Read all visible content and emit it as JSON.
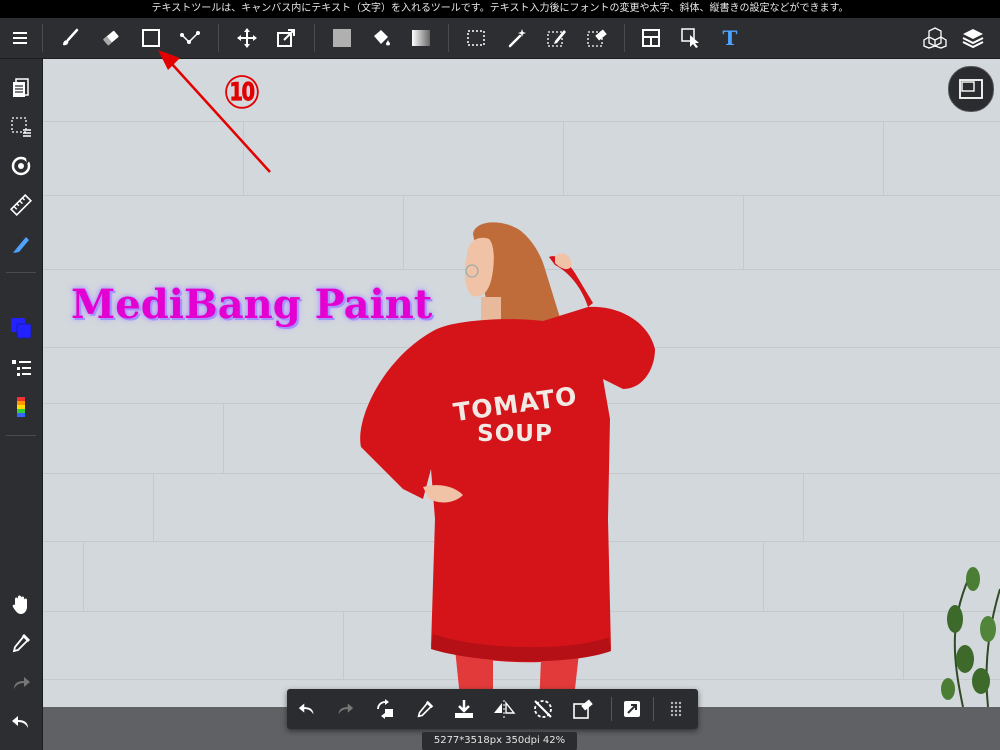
{
  "status_bar": {
    "hint": "テキストツールは、キャンバス内にテキスト（文字）を入れるツールです。テキスト入力後にフォントの変更や太字、斜体、縦書きの設定などができます。"
  },
  "toolbar": {
    "items": [
      {
        "icon": "menu-icon"
      },
      {
        "icon": "brush-icon"
      },
      {
        "icon": "eraser-icon"
      },
      {
        "icon": "rectangle-shape-icon"
      },
      {
        "icon": "curve-line-icon"
      },
      {
        "icon": "move-icon"
      },
      {
        "icon": "transform-icon"
      },
      {
        "icon": "fill-color-icon"
      },
      {
        "icon": "bucket-icon"
      },
      {
        "icon": "gradient-icon"
      },
      {
        "icon": "select-icon"
      },
      {
        "icon": "magic-wand-icon"
      },
      {
        "icon": "select-pen-icon"
      },
      {
        "icon": "select-eraser-icon"
      },
      {
        "icon": "divide-icon"
      },
      {
        "icon": "operation-icon"
      },
      {
        "icon": "text-tool-icon",
        "label": "T",
        "color": "#4ea3ff"
      },
      {
        "icon": "material-icon"
      },
      {
        "icon": "layers-icon"
      }
    ]
  },
  "sidebar": {
    "items": [
      {
        "icon": "page-icon"
      },
      {
        "icon": "selection-list-icon"
      },
      {
        "icon": "rotate-icon"
      },
      {
        "icon": "ruler-icon"
      },
      {
        "icon": "pen-tool-icon",
        "color": "#4ea3ff"
      },
      {
        "icon": "color-icon",
        "color": "#2222ff"
      },
      {
        "icon": "layer-list-icon"
      },
      {
        "icon": "palette-icon"
      },
      {
        "icon": "hand-icon"
      },
      {
        "icon": "eyedropper-icon"
      },
      {
        "icon": "redo-icon"
      },
      {
        "icon": "undo-icon"
      }
    ]
  },
  "canvas": {
    "overlay_text": "MediBang Paint",
    "sweatshirt_text": {
      "line1": "TOMATO",
      "line2": "SOUP"
    },
    "shirt_color": "#d5141a",
    "wall_color": "#d3d8dd",
    "text_color": "#e400d0"
  },
  "annotation": {
    "number": "⑩",
    "color": "#e30000"
  },
  "bottom_bar": {
    "items": [
      {
        "icon": "undo-icon"
      },
      {
        "icon": "redo-icon"
      },
      {
        "icon": "transform-layer-icon"
      },
      {
        "icon": "eyedropper-icon"
      },
      {
        "icon": "save-download-icon"
      },
      {
        "icon": "flip-horizontal-icon"
      },
      {
        "icon": "no-rotate-icon"
      },
      {
        "icon": "clear-icon"
      },
      {
        "icon": "fullscreen-icon"
      },
      {
        "icon": "more-icon"
      }
    ]
  },
  "canvas_info": "5277*3518px 350dpi 42%"
}
